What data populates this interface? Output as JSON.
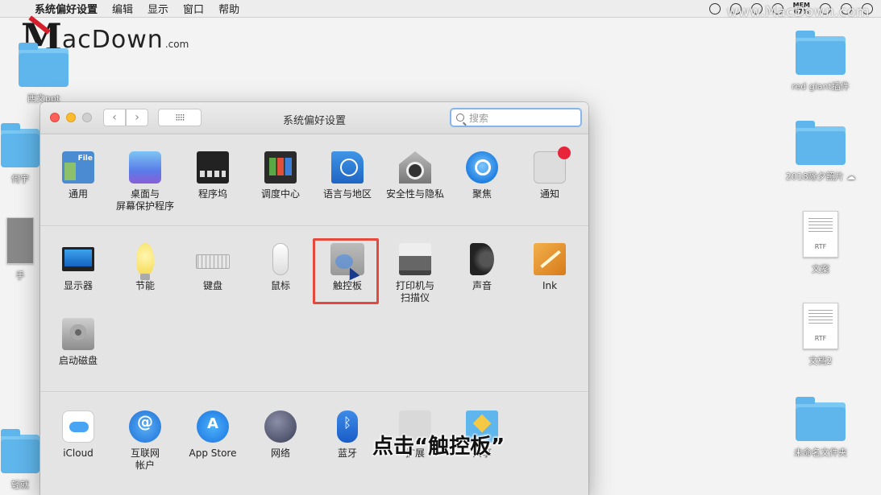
{
  "menubar": {
    "apple_icon": "apple-logo-icon",
    "items": [
      "系统偏好设置",
      "编辑",
      "显示",
      "窗口",
      "帮助"
    ],
    "mem_label": "MEM",
    "mem_value": "67%",
    "watermark": "www.MacDown.com"
  },
  "logo": {
    "m": "M",
    "rest": "acDown",
    "suffix": ".com"
  },
  "desktop": {
    "left_items": [
      {
        "label": "西文ppt"
      },
      {
        "label": "何宇"
      },
      {
        "label": "手"
      },
      {
        "label": "轻就"
      }
    ],
    "right_items": [
      {
        "label": "red giant插件",
        "type": "folder"
      },
      {
        "label": "2018除夕照片 ☁",
        "type": "folder"
      },
      {
        "label": "文案",
        "type": "doc",
        "tag": "RTF"
      },
      {
        "label": "文档2",
        "type": "doc",
        "tag": "RTF"
      },
      {
        "label": "未命名文件夹",
        "type": "folder"
      }
    ]
  },
  "window": {
    "title": "系统偏好设置",
    "search_placeholder": "搜索",
    "nav_back": "‹",
    "nav_forward": "›",
    "grid_button": "⁝⁝⁝⁝",
    "section1": [
      {
        "label": "通用",
        "icon": "general-icon"
      },
      {
        "label": "桌面与\n屏幕保护程序",
        "icon": "desktop-screensaver-icon"
      },
      {
        "label": "程序坞",
        "icon": "dock-icon"
      },
      {
        "label": "调度中心",
        "icon": "mission-control-icon"
      },
      {
        "label": "语言与地区",
        "icon": "language-region-icon"
      },
      {
        "label": "安全性与隐私",
        "icon": "security-privacy-icon"
      },
      {
        "label": "聚焦",
        "icon": "spotlight-icon"
      },
      {
        "label": "通知",
        "icon": "notifications-icon"
      }
    ],
    "section2": [
      {
        "label": "显示器",
        "icon": "displays-icon"
      },
      {
        "label": "节能",
        "icon": "energy-saver-icon"
      },
      {
        "label": "键盘",
        "icon": "keyboard-icon"
      },
      {
        "label": "鼠标",
        "icon": "mouse-icon"
      },
      {
        "label": "触控板",
        "icon": "trackpad-icon"
      },
      {
        "label": "打印机与\n扫描仪",
        "icon": "printers-scanners-icon"
      },
      {
        "label": "声音",
        "icon": "sound-icon"
      },
      {
        "label": "Ink",
        "icon": "ink-icon"
      },
      {
        "label": "启动磁盘",
        "icon": "startup-disk-icon"
      }
    ],
    "section3": [
      {
        "label": "iCloud",
        "icon": "icloud-icon"
      },
      {
        "label": "互联网\n帐户",
        "icon": "internet-accounts-icon"
      },
      {
        "label": "App Store",
        "icon": "app-store-icon"
      },
      {
        "label": "网络",
        "icon": "network-icon"
      },
      {
        "label": "蓝牙",
        "icon": "bluetooth-icon"
      },
      {
        "label": "扩展",
        "icon": "extensions-icon"
      },
      {
        "label": "共享",
        "icon": "sharing-icon"
      }
    ]
  },
  "caption": "点击“触控板”",
  "colors": {
    "highlight": "#e5483c",
    "folder": "#5fb6ec",
    "search_focus": "#84b6ec"
  }
}
